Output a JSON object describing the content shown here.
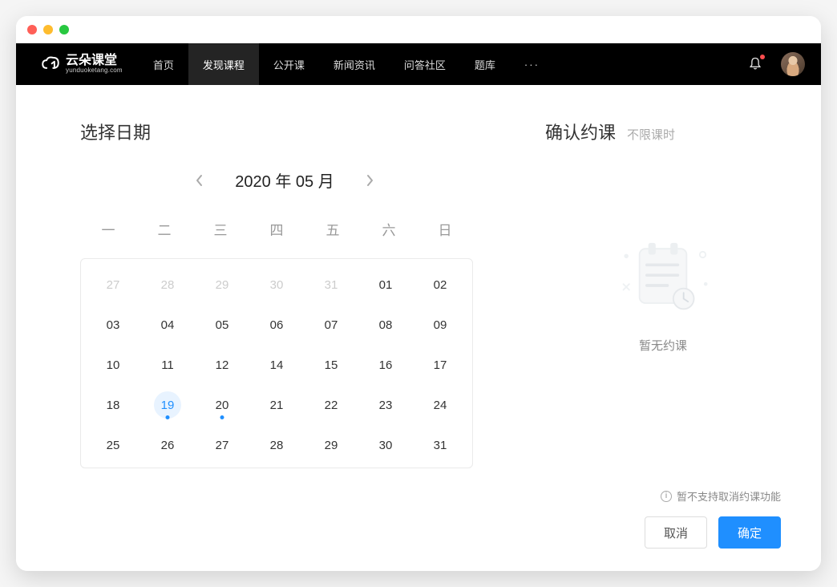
{
  "logo": {
    "main": "云朵课堂",
    "sub": "yunduoketang.com"
  },
  "nav": {
    "items": [
      {
        "label": "首页",
        "active": false
      },
      {
        "label": "发现课程",
        "active": true
      },
      {
        "label": "公开课",
        "active": false
      },
      {
        "label": "新闻资讯",
        "active": false
      },
      {
        "label": "问答社区",
        "active": false
      },
      {
        "label": "题库",
        "active": false
      }
    ],
    "more": "···"
  },
  "left": {
    "title": "选择日期",
    "month_label": "2020 年 05 月",
    "weekdays": [
      "一",
      "二",
      "三",
      "四",
      "五",
      "六",
      "日"
    ],
    "days": [
      {
        "n": "27",
        "other": true
      },
      {
        "n": "28",
        "other": true
      },
      {
        "n": "29",
        "other": true
      },
      {
        "n": "30",
        "other": true
      },
      {
        "n": "31",
        "other": true
      },
      {
        "n": "01"
      },
      {
        "n": "02"
      },
      {
        "n": "03"
      },
      {
        "n": "04"
      },
      {
        "n": "05"
      },
      {
        "n": "06"
      },
      {
        "n": "07"
      },
      {
        "n": "08"
      },
      {
        "n": "09"
      },
      {
        "n": "10"
      },
      {
        "n": "11"
      },
      {
        "n": "12"
      },
      {
        "n": "14"
      },
      {
        "n": "15"
      },
      {
        "n": "16"
      },
      {
        "n": "17"
      },
      {
        "n": "18"
      },
      {
        "n": "19",
        "selected": true,
        "dot": true
      },
      {
        "n": "20",
        "dot": true
      },
      {
        "n": "21"
      },
      {
        "n": "22"
      },
      {
        "n": "23"
      },
      {
        "n": "24"
      },
      {
        "n": "25"
      },
      {
        "n": "26"
      },
      {
        "n": "27"
      },
      {
        "n": "28"
      },
      {
        "n": "29"
      },
      {
        "n": "30"
      },
      {
        "n": "31"
      }
    ]
  },
  "right": {
    "title": "确认约课",
    "sub": "不限课时",
    "empty_text": "暂无约课",
    "notice": "暂不支持取消约课功能",
    "cancel": "取消",
    "confirm": "确定"
  }
}
